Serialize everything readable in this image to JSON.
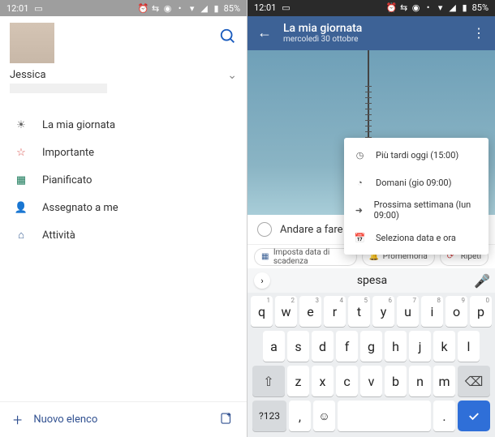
{
  "statusbar": {
    "time": "12:01",
    "battery": "85%"
  },
  "left": {
    "user_name": "Jessica",
    "menu": [
      {
        "label": "La mia giornata"
      },
      {
        "label": "Importante"
      },
      {
        "label": "Pianificato"
      },
      {
        "label": "Assegnato a me"
      },
      {
        "label": "Attività"
      }
    ],
    "new_list": "Nuovo elenco"
  },
  "right": {
    "title": "La mia giornata",
    "subtitle": "mercoledì 30 ottobre",
    "dropdown": [
      {
        "label": "Più tardi oggi (15:00)"
      },
      {
        "label": "Domani (gio 09:00)"
      },
      {
        "label": "Prossima settimana (lun 09:00)"
      },
      {
        "label": "Seleziona data e ora"
      }
    ],
    "task_text": "Andare a fare la",
    "chips": {
      "due": "Imposta data di scadenza",
      "reminder": "Promemoria",
      "repeat": "Ripeti"
    },
    "keyboard": {
      "suggestion": "spesa",
      "row1": [
        {
          "k": "q",
          "n": "1"
        },
        {
          "k": "w",
          "n": "2"
        },
        {
          "k": "e",
          "n": "3"
        },
        {
          "k": "r",
          "n": "4"
        },
        {
          "k": "t",
          "n": "5"
        },
        {
          "k": "y",
          "n": "6"
        },
        {
          "k": "u",
          "n": "7"
        },
        {
          "k": "i",
          "n": "8"
        },
        {
          "k": "o",
          "n": "9"
        },
        {
          "k": "p",
          "n": "0"
        }
      ],
      "row2": [
        "a",
        "s",
        "d",
        "f",
        "g",
        "h",
        "j",
        "k",
        "l"
      ],
      "row3": [
        "z",
        "x",
        "c",
        "v",
        "b",
        "n",
        "m"
      ],
      "sym": "?123",
      "comma": ",",
      "dot": "."
    }
  }
}
